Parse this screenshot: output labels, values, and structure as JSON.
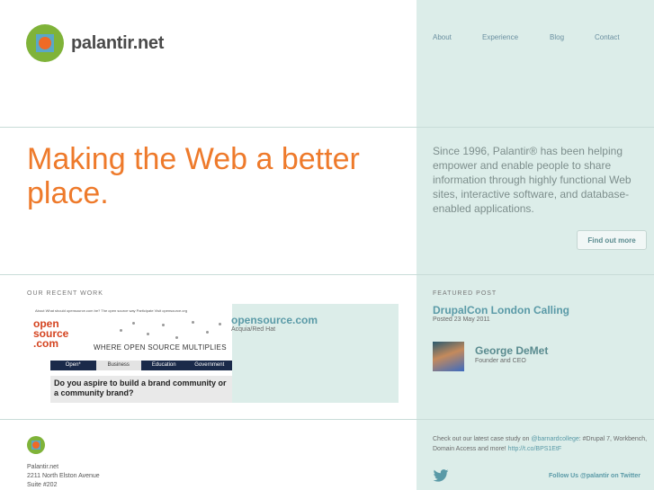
{
  "brand": {
    "name": "palantir.net"
  },
  "nav": {
    "items": [
      "About",
      "Experience",
      "Blog",
      "Contact"
    ]
  },
  "hero": {
    "headline": "Making the Web a better place.",
    "intro": "Since 1996, Palantir® has been helping empower and enable people to share information through highly functional Web sites, interactive software, and database-enabled applications.",
    "cta": "Find out more"
  },
  "recent_work": {
    "label": "OUR RECENT WORK",
    "title": "opensource.com",
    "subtitle": "Acquia/Red Hat",
    "screenshot": {
      "nav": "About   What should opensource.com be?   The open source way   Participate   Visit opensource.org",
      "logo_line1": "open",
      "logo_line2": "source",
      "logo_line3": ".com",
      "tagline": "WHERE OPEN SOURCE MULTIPLIES",
      "tabs": [
        "Open*",
        "Business",
        "Education",
        "Government"
      ],
      "question": "Do you aspire to build a brand community or a community brand?"
    }
  },
  "featured_post": {
    "label": "FEATURED POST",
    "title": "DrupalCon London Calling",
    "date": "Posted 23 May 2011",
    "author_name": "George DeMet",
    "author_role": "Founder and CEO"
  },
  "twitter": {
    "text_before": "Check out our latest case study on ",
    "mention": "@barnardcollege",
    "text_after": ": #Drupal 7, Workbench, Domain Access and more! ",
    "link": "http://t.co/BPS1EtF",
    "follow": "Follow Us @palantir on Twitter",
    "icon": "twitter-bird-icon"
  },
  "footer": {
    "line1": "Palantir.net",
    "line2": "2211 North Elston Avenue",
    "line3": "Suite #202"
  },
  "colors": {
    "accent": "#ee7a2b",
    "panel": "#dcede9",
    "link": "#5a9aa7",
    "logo_green": "#7fb339",
    "logo_blue": "#5aa7c8"
  }
}
